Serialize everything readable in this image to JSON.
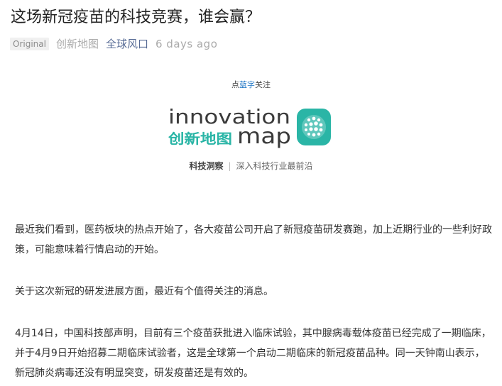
{
  "article": {
    "title": "这场新冠疫苗的科技竞赛，谁会赢？",
    "badge": "Original",
    "author": "创新地图",
    "account": "全球风口",
    "date": "6 days ago"
  },
  "banner": {
    "follow_prefix": "点",
    "follow_highlight": "蓝字",
    "follow_suffix": "关注",
    "logo_en_top": "innovation",
    "logo_cn": "创新地图",
    "logo_en_bottom": "map",
    "slogan_left": "科技洞察",
    "slogan_sep": "|",
    "slogan_right": "深入科技行业最前沿",
    "accent_color": "#1a73c4",
    "logo_color": "#3a3a3a",
    "logo_teal": "#2ab5a6"
  },
  "body": {
    "paragraphs": [
      "最近我们看到，医药板块的热点开始了，各大疫苗公司开启了新冠疫苗研发赛跑，加上近期行业的一些利好政策，可能意味着行情启动的开始。",
      "关于这次新冠的研发进展方面，最近有个值得关注的消息。",
      "4月14日，中国科技部声明，目前有三个疫苗获批进入临床试验，其中腺病毒载体疫苗已经完成了一期临床，并于4月9日开始招募二期临床试验者，这是全球第一个启动二期临床的新冠疫苗品种。同一天钟南山表示，新冠肺炎病毒还没有明显突变，研发疫苗还是有效的。"
    ]
  }
}
